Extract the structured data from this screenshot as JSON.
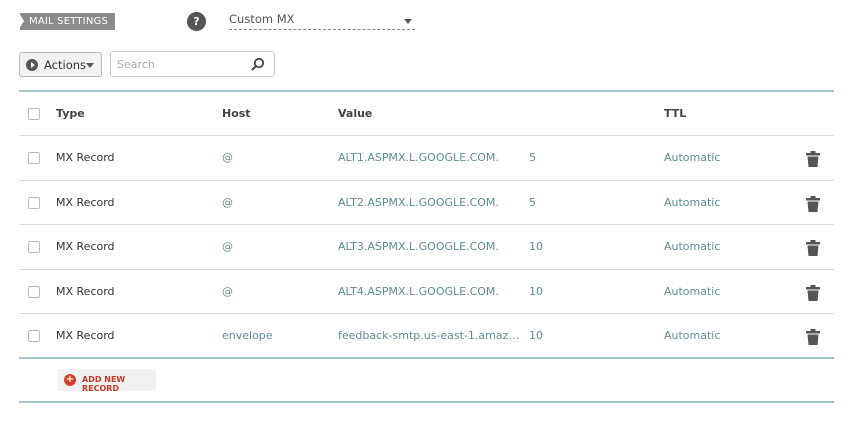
{
  "mail_settings": {
    "tag_label": "MAIL SETTINGS",
    "help_label": "?",
    "selected_mode": "Custom MX"
  },
  "toolbar": {
    "actions_label": "Actions",
    "search_placeholder": "Search",
    "search_value": ""
  },
  "table": {
    "columns": {
      "type": "Type",
      "host": "Host",
      "value": "Value",
      "ttl": "TTL"
    },
    "rows": [
      {
        "type": "MX Record",
        "host": "@",
        "value": "ALT1.ASPMX.L.GOOGLE.COM.",
        "priority": "5",
        "ttl": "Automatic"
      },
      {
        "type": "MX Record",
        "host": "@",
        "value": "ALT2.ASPMX.L.GOOGLE.COM.",
        "priority": "5",
        "ttl": "Automatic"
      },
      {
        "type": "MX Record",
        "host": "@",
        "value": "ALT3.ASPMX.L.GOOGLE.COM.",
        "priority": "10",
        "ttl": "Automatic"
      },
      {
        "type": "MX Record",
        "host": "@",
        "value": "ALT4.ASPMX.L.GOOGLE.COM.",
        "priority": "10",
        "ttl": "Automatic"
      },
      {
        "type": "MX Record",
        "host": "envelope",
        "value": "feedback-smtp.us-east-1.amazonses...",
        "priority": "10",
        "ttl": "Automatic"
      }
    ],
    "add_label": "ADD NEW RECORD"
  },
  "icons": {
    "help": "help-icon",
    "play": "play-icon",
    "search": "search-icon",
    "trash": "trash-icon",
    "plus": "plus-icon"
  },
  "colors": {
    "accent_line": "#9fc9ce",
    "link_text": "#5d8e93",
    "add_red": "#d0402b"
  }
}
